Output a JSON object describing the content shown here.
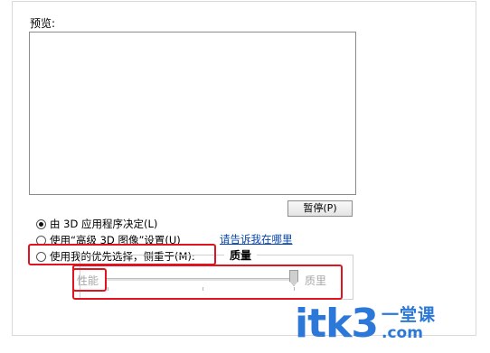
{
  "preview": {
    "label": "预览:",
    "pause_button": "暂停(P)"
  },
  "options": [
    {
      "label": "由 3D 应用程序决定(L)",
      "checked": true
    },
    {
      "label": "使用“高级 3D 图像”设置(U)",
      "checked": false
    },
    {
      "label": "使用我的优先选择，侧重于(M):",
      "checked": false
    }
  ],
  "help_link": "请告诉我在哪里",
  "quality_group": {
    "title": "质量",
    "left_label": "性能",
    "right_label": "质里",
    "slider_value": 1.0
  },
  "watermark": {
    "main": "itk3",
    "cn": "一堂课",
    "com": ".com"
  },
  "colors": {
    "highlight": "#e0141e",
    "link": "#0645ad",
    "watermark": "#2b78d8"
  }
}
